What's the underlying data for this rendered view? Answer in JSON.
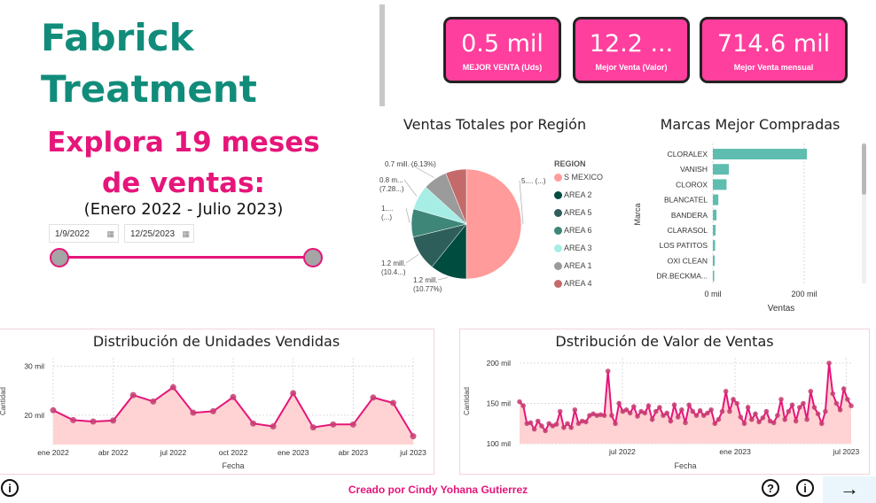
{
  "header": {
    "title": "Fabrick\nTreatment",
    "subtitle": "Explora 19 meses de ventas:",
    "range": "(Enero 2022 - Julio 2023)"
  },
  "slicer": {
    "start": "1/9/2022",
    "end": "12/25/2023"
  },
  "kpis": [
    {
      "value": "0.5 mil",
      "label": "MEJOR VENTA (Uds)"
    },
    {
      "value": "12.2 ...",
      "label": "Mejor Venta (Valor)"
    },
    {
      "value": "714.6 mil",
      "label": "Mejor Venta mensual"
    }
  ],
  "colors": {
    "accent": "#e6157a",
    "title": "#118c7a",
    "kpi_bg": "#ff3f9e",
    "bar": "#5fbdb0",
    "area": "#ffd3d3"
  },
  "pie_chart": {
    "title": "Ventas Totales por Región",
    "legend_title": "REGION",
    "slices": [
      {
        "region": "S MEXICO",
        "pct": 50.0,
        "color": "#ff9b9b",
        "label1": "5.... (...)",
        "label2": ""
      },
      {
        "region": "AREA 2",
        "pct": 10.77,
        "color": "#004d40",
        "label1": "1.2 mill.",
        "label2": "(10.77%)"
      },
      {
        "region": "AREA 5",
        "pct": 10.4,
        "color": "#2e5e5a",
        "label1": "1.2 mill.",
        "label2": "(10.4...)"
      },
      {
        "region": "AREA 6",
        "pct": 8.3,
        "color": "#3d8678",
        "label1": "1....",
        "label2": "(...)"
      },
      {
        "region": "AREA 3",
        "pct": 7.28,
        "color": "#a6ede6",
        "label1": "0.8 m...",
        "label2": "(7.28...)"
      },
      {
        "region": "AREA 1",
        "pct": 7.12,
        "color": "#9b9b9b",
        "label1": "0.7 mill. (6.13%)",
        "label2": ""
      },
      {
        "region": "AREA 4",
        "pct": 6.13,
        "color": "#c46a6a",
        "label1": "",
        "label2": ""
      }
    ]
  },
  "bar_chart": {
    "title": "Marcas Mejor Compradas",
    "ylabel": "Marca",
    "xlabel": "Ventas",
    "ticks": [
      "0 mil",
      "200 mil"
    ],
    "xmax": 200,
    "categories": [
      "CLORALEX",
      "VANISH",
      "CLOROX",
      "BLANCATEL",
      "BANDERA",
      "CLARASOL",
      "LOS PATITOS",
      "OXI CLEAN",
      "DR.BECKMA..."
    ],
    "values": [
      206,
      35,
      30,
      12,
      8,
      6,
      5,
      4,
      3
    ]
  },
  "units_chart": {
    "title": "Distribución de Unidades Vendidas",
    "ylabel": "Cantidad",
    "xlabel": "Fecha",
    "y_ticks": [
      "30 mil",
      "20 mil"
    ],
    "x_ticks": [
      "ene 2022",
      "abr 2022",
      "jul 2022",
      "oct 2022",
      "ene 2023",
      "abr 2023",
      "jul 2023"
    ],
    "chart_data": {
      "type": "area",
      "ylim": [
        14,
        31
      ],
      "x": [
        "2022-01",
        "2022-02",
        "2022-03",
        "2022-04",
        "2022-05",
        "2022-06",
        "2022-07",
        "2022-08",
        "2022-09",
        "2022-10",
        "2022-11",
        "2022-12",
        "2023-01",
        "2023-02",
        "2023-03",
        "2023-04",
        "2023-05",
        "2023-06",
        "2023-07"
      ],
      "values": [
        21.0,
        19.0,
        18.7,
        18.9,
        24.1,
        22.8,
        25.7,
        20.5,
        20.8,
        23.7,
        18.3,
        17.7,
        24.5,
        17.5,
        18.1,
        18.1,
        23.6,
        22.5,
        15.7
      ]
    }
  },
  "value_chart": {
    "title": "Dstribución de Valor de Ventas",
    "ylabel": "Cantidad",
    "xlabel": "Fecha",
    "y_ticks": [
      "200 mil",
      "150 mil",
      "100 mil"
    ],
    "x_ticks": [
      "jul 2022",
      "ene 2023",
      "jul 2023"
    ],
    "chart_data": {
      "type": "area",
      "ylim": [
        100,
        200
      ],
      "x_range": [
        "2022-01-09",
        "2023-07-30"
      ],
      "values": [
        152,
        147,
        125,
        126,
        118,
        128,
        122,
        116,
        125,
        122,
        124,
        140,
        120,
        125,
        120,
        142,
        125,
        128,
        127,
        135,
        137,
        135,
        136,
        135,
        190,
        135,
        125,
        150,
        140,
        142,
        138,
        146,
        134,
        140,
        138,
        147,
        130,
        140,
        145,
        135,
        138,
        128,
        148,
        133,
        142,
        126,
        148,
        140,
        135,
        141,
        135,
        138,
        142,
        125,
        130,
        140,
        165,
        140,
        155,
        150,
        133,
        125,
        145,
        130,
        137,
        127,
        132,
        140,
        128,
        126,
        135,
        155,
        130,
        140,
        148,
        128,
        145,
        150,
        130,
        165,
        145,
        137,
        125,
        140,
        200,
        162,
        150,
        142,
        168,
        155,
        147
      ]
    }
  },
  "footer": {
    "credit": "Creado por Cindy Yohana Gutierrez",
    "arrow": "→",
    "info": "i",
    "help": "?"
  }
}
